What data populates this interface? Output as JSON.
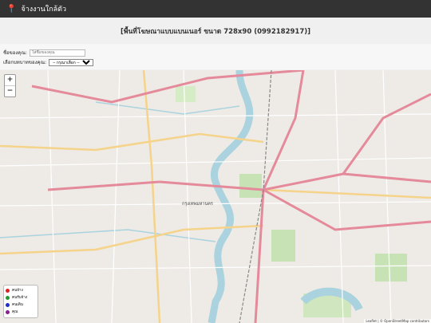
{
  "app": {
    "title": "จ้างงานใกล้ตัว"
  },
  "banner": {
    "text": "[พื้นที่โฆษณาแบบแบนเนอร์ ขนาด 728x90 (0992182917)]"
  },
  "form": {
    "name_label": "ชื่อของคุณ:",
    "name_placeholder": "ใส่ชื่อของคุณ",
    "status_label": "เลือกบทบาทของคุณ:",
    "status_selected": "-- กรุณาเลือก --"
  },
  "map": {
    "zoom_in": "+",
    "zoom_out": "−",
    "district_label": "กรุงเทพมหานคร",
    "attribution": "Leaflet | © OpenStreetMap contributors"
  },
  "legend": {
    "items": [
      {
        "label": "คนจ้าง",
        "color": "#e02020"
      },
      {
        "label": "คนรับจ้าง",
        "color": "#1f9a2c"
      },
      {
        "label": "คนเดิน",
        "color": "#1c2fc7"
      },
      {
        "label": "คุณ",
        "color": "#8a1e8e"
      }
    ]
  }
}
